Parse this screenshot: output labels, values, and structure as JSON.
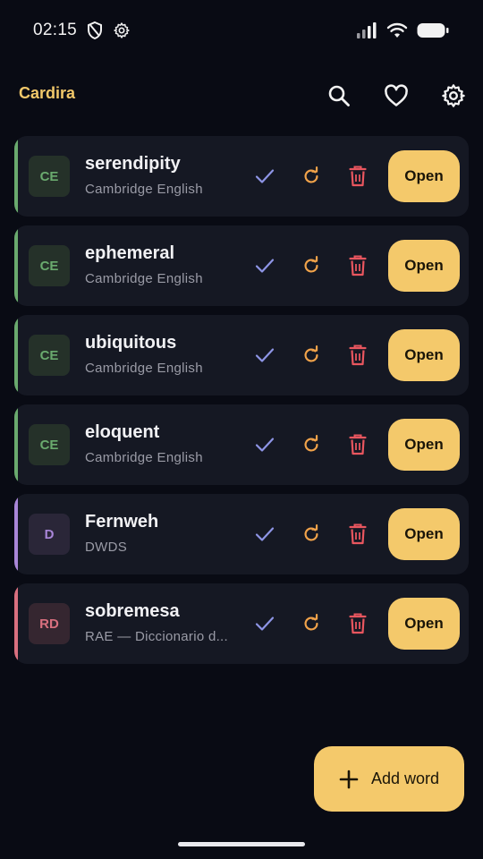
{
  "status_bar": {
    "time": "02:15"
  },
  "app_bar": {
    "title": "Cardira"
  },
  "colors": {
    "accent_yellow": "#f4c96b",
    "green": "#6aaa6e",
    "purple": "#a986d8",
    "pink": "#d9707f",
    "check_blue": "#8e95e6",
    "refresh_orange": "#f0a24a",
    "delete_red": "#e9565f"
  },
  "words": [
    {
      "badge": "CE",
      "word": "serendipity",
      "source": "Cambridge English",
      "color": "green",
      "open_label": "Open"
    },
    {
      "badge": "CE",
      "word": "ephemeral",
      "source": "Cambridge English",
      "color": "green",
      "open_label": "Open"
    },
    {
      "badge": "CE",
      "word": "ubiquitous",
      "source": "Cambridge English",
      "color": "green",
      "open_label": "Open"
    },
    {
      "badge": "CE",
      "word": "eloquent",
      "source": "Cambridge English",
      "color": "green",
      "open_label": "Open"
    },
    {
      "badge": "D",
      "word": "Fernweh",
      "source": "DWDS",
      "color": "purple",
      "open_label": "Open"
    },
    {
      "badge": "RD",
      "word": "sobremesa",
      "source": "RAE — Diccionario d...",
      "color": "pink",
      "open_label": "Open"
    }
  ],
  "fab": {
    "label": "Add word",
    "icon": "plus-icon"
  }
}
